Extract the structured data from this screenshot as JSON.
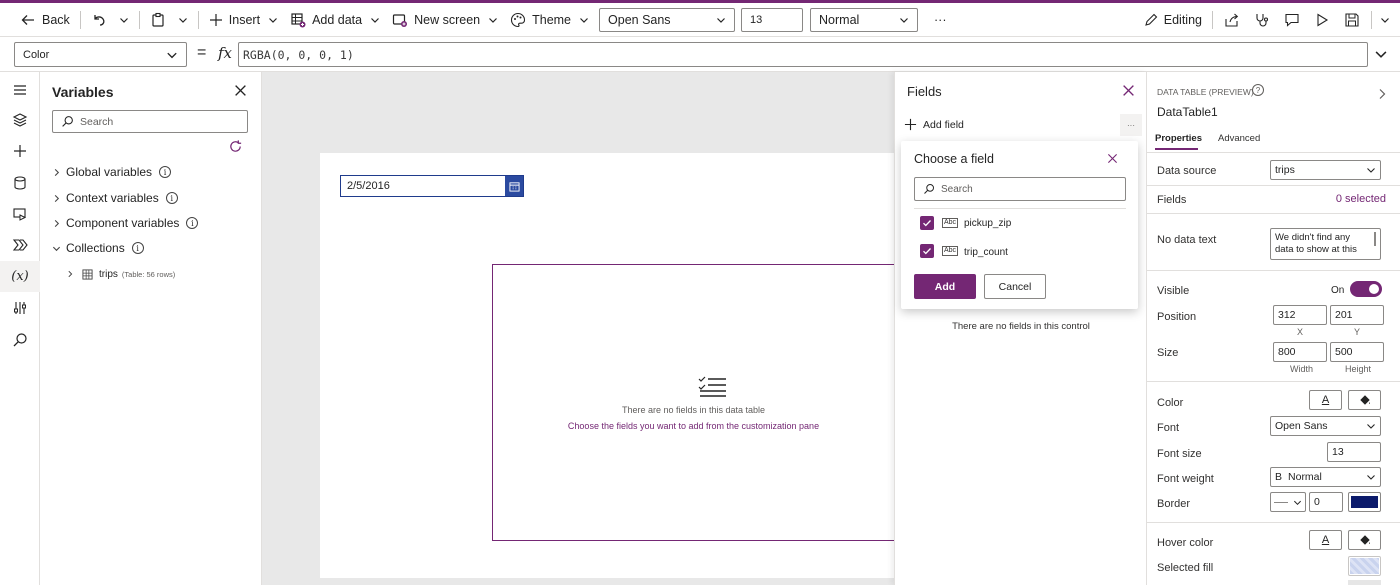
{
  "toolbar": {
    "back": "Back",
    "insert": "Insert",
    "add_data": "Add data",
    "new_screen": "New screen",
    "theme": "Theme",
    "font_family": "Open Sans",
    "font_size": "13",
    "font_weight": "Normal",
    "more": "···",
    "editing": "Editing"
  },
  "formula": {
    "property": "Color",
    "fx": "fx",
    "value": "RGBA(0, 0, 0, 1)"
  },
  "variables_pane": {
    "title": "Variables",
    "search_placeholder": "Search",
    "items": [
      {
        "label": "Global variables"
      },
      {
        "label": "Context variables"
      },
      {
        "label": "Component variables"
      },
      {
        "label": "Collections"
      }
    ],
    "collection": {
      "name": "trips",
      "meta": "(Table: 56 rows)"
    }
  },
  "canvas": {
    "date_value": "2/5/2016",
    "empty_title": "There are no fields in this data table",
    "empty_link": "Choose the fields you want to add from the customization pane"
  },
  "fields_pane": {
    "title": "Fields",
    "add_field": "Add field",
    "more": "···",
    "no_fields": "There are no fields in this control"
  },
  "choose_field": {
    "title": "Choose a field",
    "search_placeholder": "Search",
    "abc": "Abc",
    "fields": [
      {
        "name": "pickup_zip",
        "checked": true
      },
      {
        "name": "trip_count",
        "checked": true
      }
    ],
    "add": "Add",
    "cancel": "Cancel"
  },
  "properties": {
    "type": "DATA TABLE (PREVIEW)",
    "name": "DataTable1",
    "tab_properties": "Properties",
    "tab_advanced": "Advanced",
    "data_source_label": "Data source",
    "data_source": "trips",
    "fields_label": "Fields",
    "fields_value": "0 selected",
    "no_data_text_label": "No data text",
    "no_data_text": "We didn't find any data to show at this",
    "visible_label": "Visible",
    "visible_value": "On",
    "position_label": "Position",
    "pos_x": "312",
    "pos_y": "201",
    "x_label": "X",
    "y_label": "Y",
    "size_label": "Size",
    "width": "800",
    "height": "500",
    "width_label": "Width",
    "height_label": "Height",
    "color_label": "Color",
    "font_label": "Font",
    "font": "Open Sans",
    "font_size_label": "Font size",
    "font_size": "13",
    "font_weight_label": "Font weight",
    "font_weight": "Normal",
    "border_label": "Border",
    "border_width": "0",
    "hover_color_label": "Hover color",
    "selected_fill_label": "Selected fill",
    "letter_a": "A",
    "bold_b": "B",
    "border_color": "#0b1a6b",
    "accent": "#742774"
  }
}
